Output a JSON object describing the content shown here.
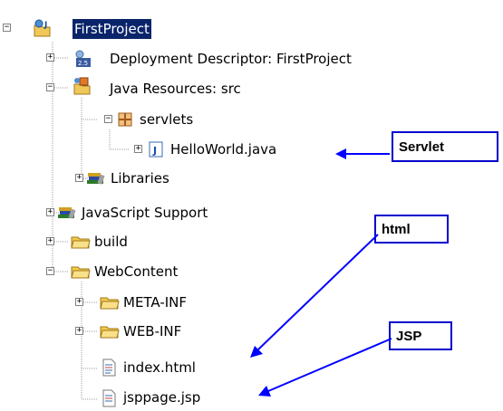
{
  "tree": {
    "root": {
      "label": "FirstProject",
      "selected": true,
      "toggle": "−"
    },
    "items": [
      {
        "id": "deployment-descriptor",
        "label": "Deployment Descriptor: FirstProject",
        "toggle": "+"
      },
      {
        "id": "java-resources",
        "label": "Java Resources: src",
        "toggle": "−"
      },
      {
        "id": "servlets",
        "label": "servlets",
        "toggle": "−"
      },
      {
        "id": "helloworld",
        "label": "HelloWorld.java",
        "toggle": "+"
      },
      {
        "id": "libraries",
        "label": "Libraries",
        "toggle": "+"
      },
      {
        "id": "javascript-support",
        "label": "JavaScript Support",
        "toggle": "+"
      },
      {
        "id": "build",
        "label": "build",
        "toggle": "+"
      },
      {
        "id": "webcontent",
        "label": "WebContent",
        "toggle": "−"
      },
      {
        "id": "meta-inf",
        "label": "META-INF",
        "toggle": "+"
      },
      {
        "id": "web-inf",
        "label": "WEB-INF",
        "toggle": "+"
      },
      {
        "id": "index-html",
        "label": "index.html"
      },
      {
        "id": "jsppage",
        "label": "jsppage.jsp"
      }
    ],
    "icon_badges": {
      "deployment_descriptor": "2.5"
    }
  },
  "annotations": {
    "servlet": "Servlet",
    "html": "html",
    "jsp": "JSP"
  },
  "colors": {
    "selection": "#0a246a",
    "arrow": "#0000ff",
    "folder": "#f2c94c",
    "callout_border": "#0000cc"
  }
}
